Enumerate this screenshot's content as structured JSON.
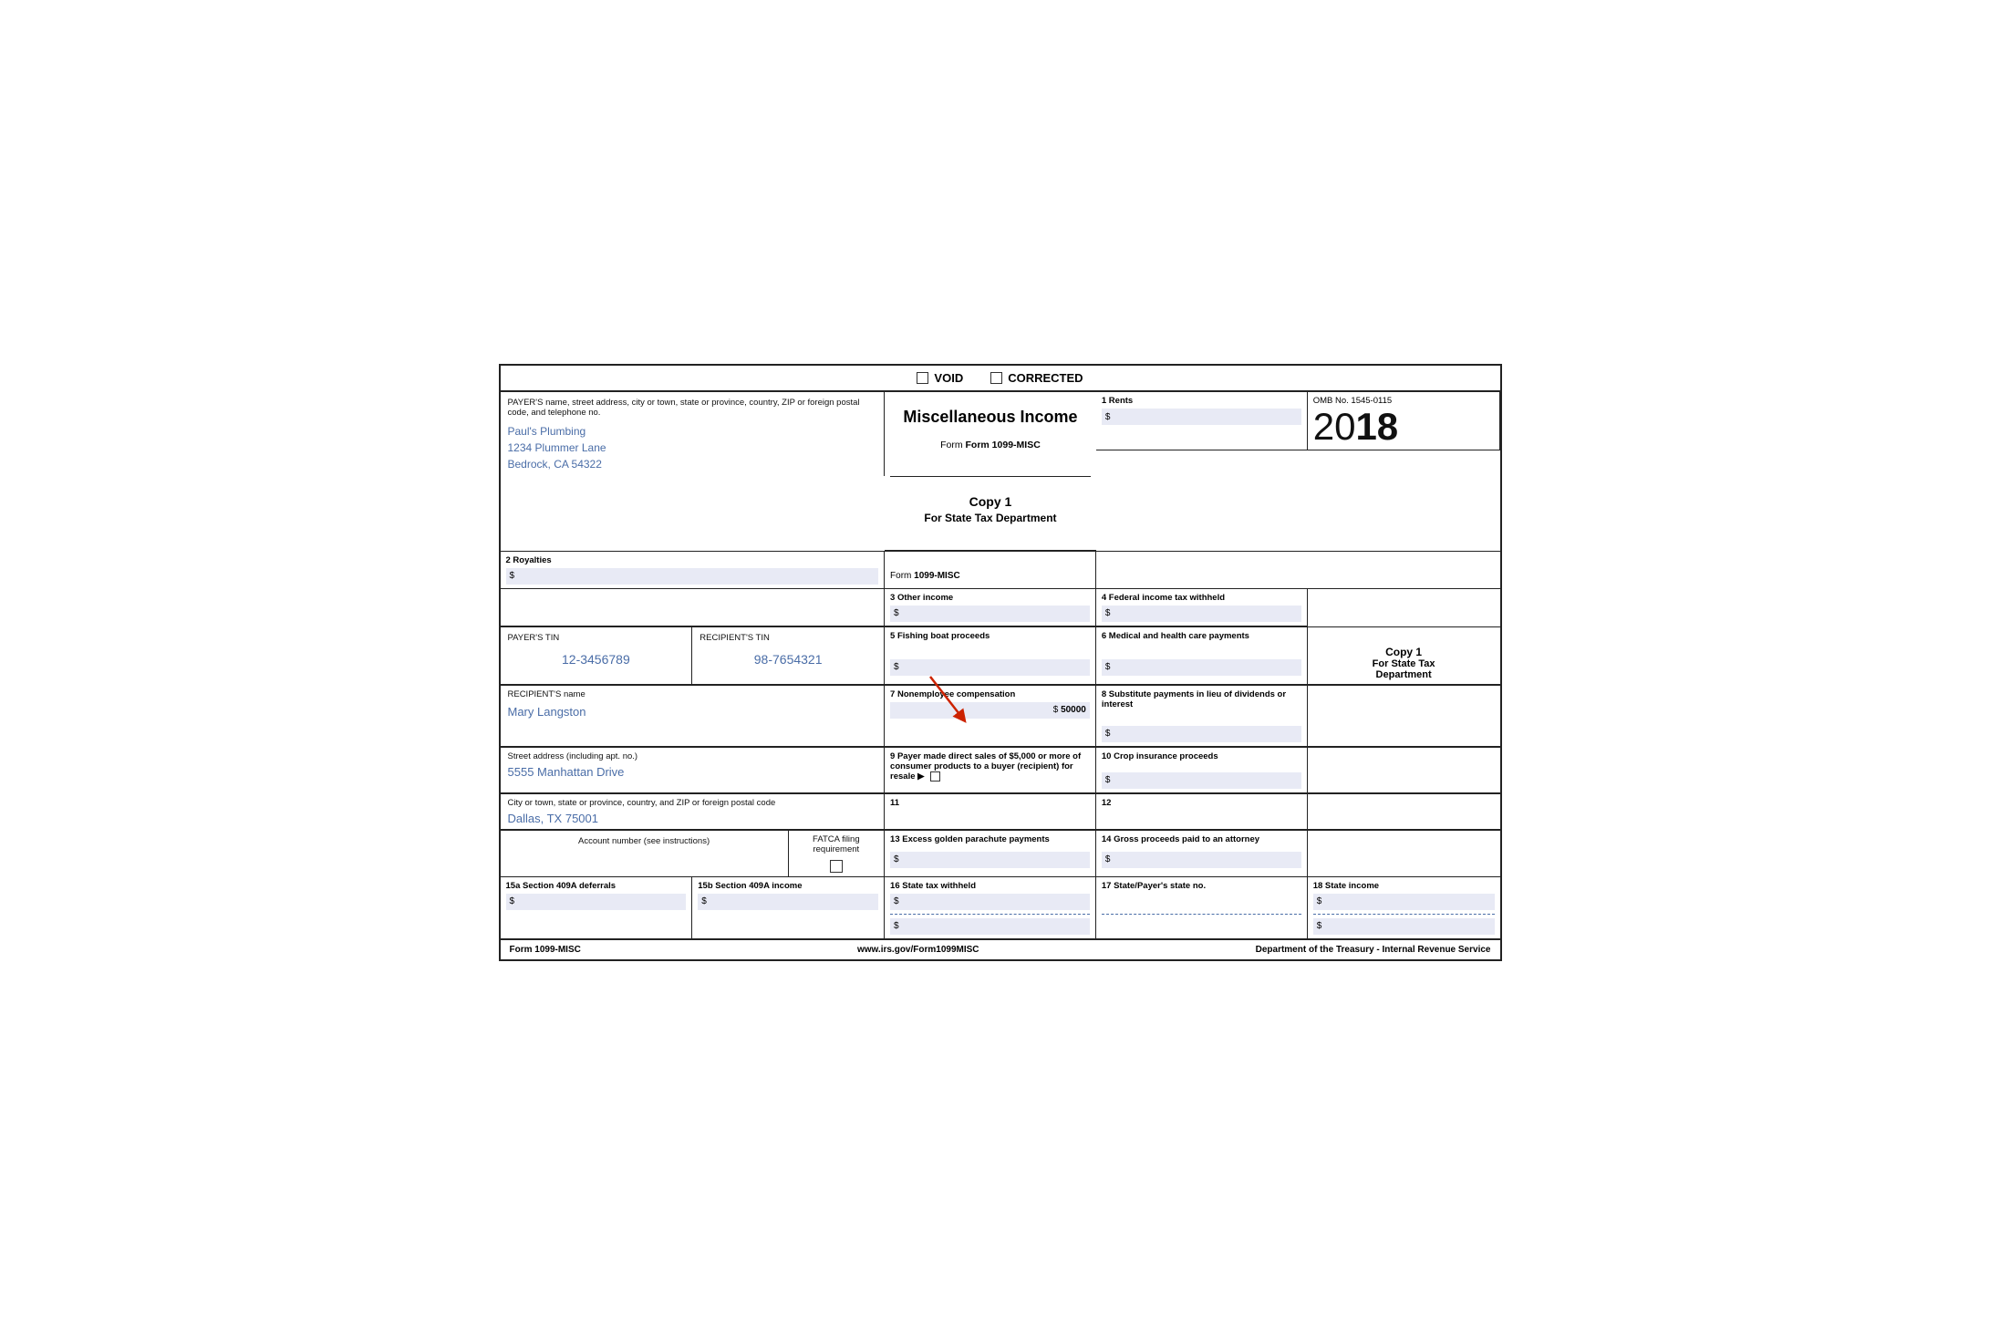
{
  "header": {
    "void_label": "VOID",
    "corrected_label": "CORRECTED"
  },
  "form": {
    "title": "Miscellaneous Income",
    "year_prefix": "20",
    "year_suffix": "18",
    "form_name": "Form 1099-MISC",
    "omb": "OMB No. 1545-0115",
    "copy_label": "Copy 1",
    "copy_for": "For State Tax Department"
  },
  "payer": {
    "label": "PAYER'S name, street address, city or town, state or province, country, ZIP or foreign postal code, and telephone no.",
    "name": "Paul's Plumbing",
    "address": "1234 Plummer Lane",
    "city_state": "Bedrock, CA 54322"
  },
  "boxes": {
    "b1_label": "1 Rents",
    "b1_value": "$",
    "b2_label": "2 Royalties",
    "b2_value": "$",
    "b3_label": "3 Other income",
    "b3_value": "$",
    "b4_label": "4 Federal income tax withheld",
    "b4_value": "$",
    "b5_label": "5 Fishing boat proceeds",
    "b5_value": "$",
    "b6_label": "6 Medical and health care payments",
    "b6_value": "$",
    "b7_label": "7 Nonemployee compensation",
    "b7_value": "$",
    "b7_amount": "50000",
    "b8_label": "8 Substitute payments in lieu of dividends or interest",
    "b8_value": "$",
    "b9_label": "9 Payer made direct sales of $5,000 or more of consumer products to a buyer (recipient) for resale ▶",
    "b10_label": "10 Crop insurance proceeds",
    "b10_value": "$",
    "b11_label": "11",
    "b12_label": "12",
    "b13_label": "13 Excess golden parachute payments",
    "b13_value": "$",
    "b14_label": "14 Gross proceeds paid to an attorney",
    "b14_value": "$",
    "b15a_label": "15a Section 409A deferrals",
    "b15a_value": "$",
    "b15b_label": "15b Section 409A income",
    "b15b_value": "$",
    "b16_label": "16 State tax withheld",
    "b16_value1": "$",
    "b16_value2": "$",
    "b17_label": "17 State/Payer's state no.",
    "b18_label": "18 State income",
    "b18_value1": "$",
    "b18_value2": "$"
  },
  "payer_tin": {
    "label": "PAYER'S TIN",
    "value": "12-3456789"
  },
  "recipient_tin": {
    "label": "RECIPIENT'S TIN",
    "value": "98-7654321"
  },
  "recipient": {
    "name_label": "RECIPIENT'S name",
    "name": "Mary Langston",
    "street_label": "Street address (including apt. no.)",
    "street": "5555 Manhattan Drive",
    "city_label": "City or town, state or province, country, and ZIP or foreign postal code",
    "city": "Dallas, TX 75001"
  },
  "account": {
    "label": "Account number (see instructions)",
    "fatca_label": "FATCA filing requirement"
  },
  "footer": {
    "form_label": "Form 1099-MISC",
    "website": "www.irs.gov/Form1099MISC",
    "dept": "Department of the Treasury - Internal Revenue Service"
  }
}
